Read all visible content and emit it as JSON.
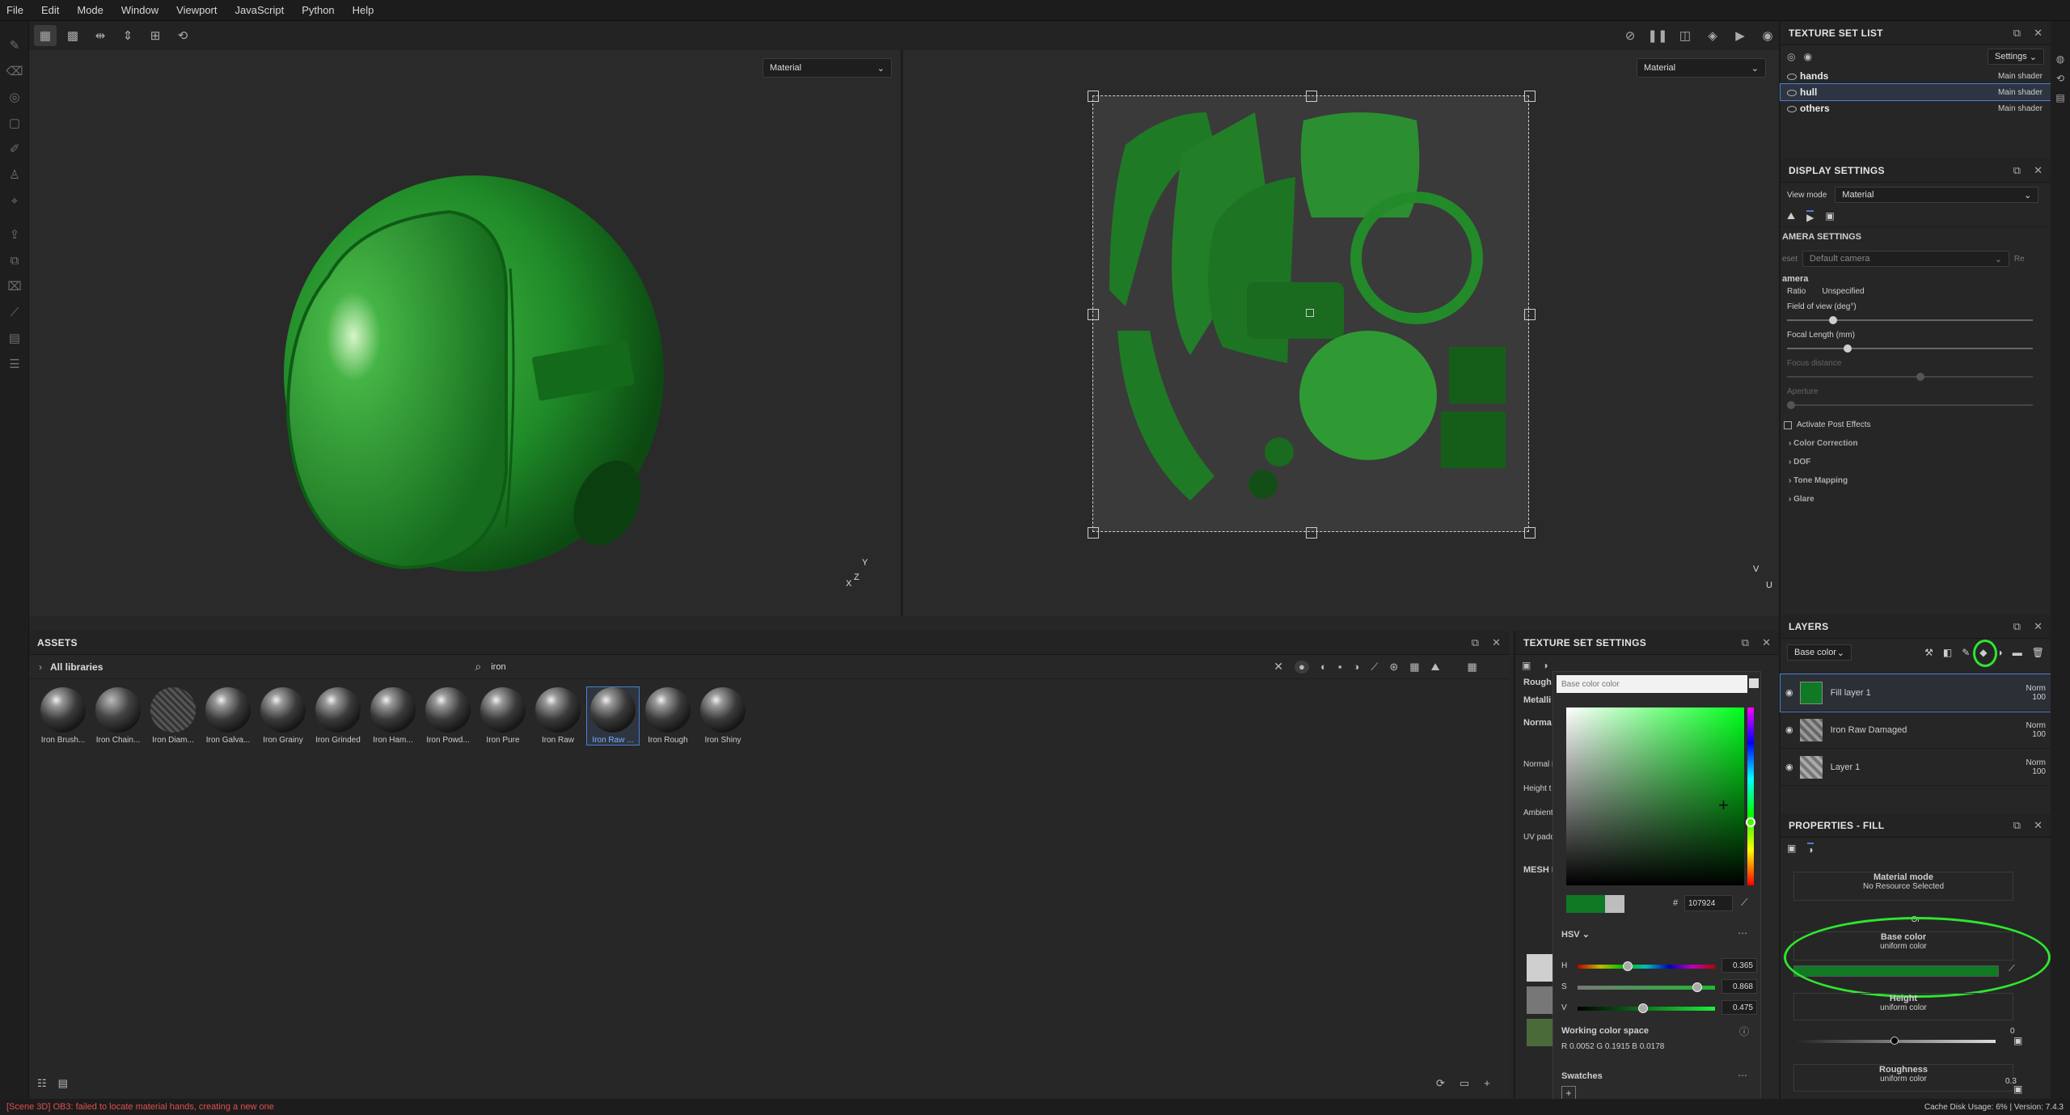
{
  "menu": [
    "File",
    "Edit",
    "Mode",
    "Window",
    "Viewport",
    "JavaScript",
    "Python",
    "Help"
  ],
  "viewport3d": {
    "mode_select": "Material",
    "axis_labels": [
      "Y",
      "X",
      "Z"
    ]
  },
  "viewport2d": {
    "mode_select": "Material",
    "axis_labels": [
      "V",
      "U"
    ]
  },
  "assets": {
    "title": "ASSETS",
    "breadcrumb": "All libraries",
    "search_value": "iron",
    "items": [
      "Iron Brush...",
      "Iron Chain...",
      "Iron Diam...",
      "Iron Galva...",
      "Iron Grainy",
      "Iron Grinded",
      "Iron Ham...",
      "Iron Powd...",
      "Iron Pure",
      "Iron Raw",
      "Iron Raw ...",
      "Iron Rough",
      "Iron Shiny"
    ],
    "selected_index": 10
  },
  "tss": {
    "title": "TEXTURE SET SETTINGS",
    "labels": [
      "Rough",
      "Metalli",
      "Norma",
      "Normal i",
      "Height t",
      "Ambient",
      "UV padd",
      "MESH I"
    ]
  },
  "color_picker": {
    "placeholder": "Base color color",
    "hex_label": "#",
    "hex_value": "107924",
    "mode": "HSV",
    "h_label": "H",
    "h_value": "0.365",
    "h_level": 0.365,
    "s_label": "S",
    "s_value": "0.868",
    "s_level": 0.868,
    "v_label": "V",
    "v_value": "0.475",
    "v_level": 0.475,
    "working_space": "Working color space",
    "rgb": "R 0.0052  G 0.1915  B 0.0178",
    "swatches": "Swatches",
    "color": "#107924"
  },
  "texture_set_list": {
    "title": "TEXTURE SET LIST",
    "settings_label": "Settings",
    "sets": [
      {
        "name": "hands",
        "shader": "Main shader"
      },
      {
        "name": "hull",
        "shader": "Main shader"
      },
      {
        "name": "others",
        "shader": "Main shader"
      }
    ]
  },
  "display_settings": {
    "title": "DISPLAY SETTINGS",
    "view_mode_label": "View mode",
    "view_mode_value": "Material",
    "camera_settings": "AMERA SETTINGS",
    "preset_label": "eset",
    "preset_value": "Default camera",
    "preset_btn": "Re",
    "camera_label": "amera",
    "ratio_label": "Ratio",
    "ratio_value": "Unspecified",
    "fov_label": "Field of view (deg°)",
    "focal_label": "Focal Length (mm)",
    "focus_label": "Focus distance",
    "aperture_label": "Aperture",
    "post_effects": "Activate Post Effects",
    "sections": [
      "Color Correction",
      "DOF",
      "Tone Mapping",
      "Glare"
    ]
  },
  "layers": {
    "title": "LAYERS",
    "channel_select": "Base color",
    "items": [
      {
        "name": "Fill layer 1",
        "blend": "Norm",
        "opacity": "100"
      },
      {
        "name": "Iron Raw Damaged",
        "blend": "Norm",
        "opacity": "100"
      },
      {
        "name": "Layer 1",
        "blend": "Norm",
        "opacity": "100"
      }
    ]
  },
  "properties": {
    "title": "PROPERTIES - FILL",
    "material_mode": "Material mode",
    "no_resource": "No Resource Selected",
    "or_label": "Or",
    "base_color": "Base color",
    "base_color_sub": "uniform color",
    "height": "Height",
    "height_sub": "uniform color",
    "height_value": "0",
    "roughness": "Roughness",
    "roughness_sub": "uniform color",
    "roughness_value": "0.3"
  },
  "status": {
    "error": "[Scene 3D] OB3: failed to locate material hands, creating a new one",
    "cache_label": "Cache Disk Usage:",
    "cache_value": "6%",
    "version": "Version: 7.4.3"
  }
}
